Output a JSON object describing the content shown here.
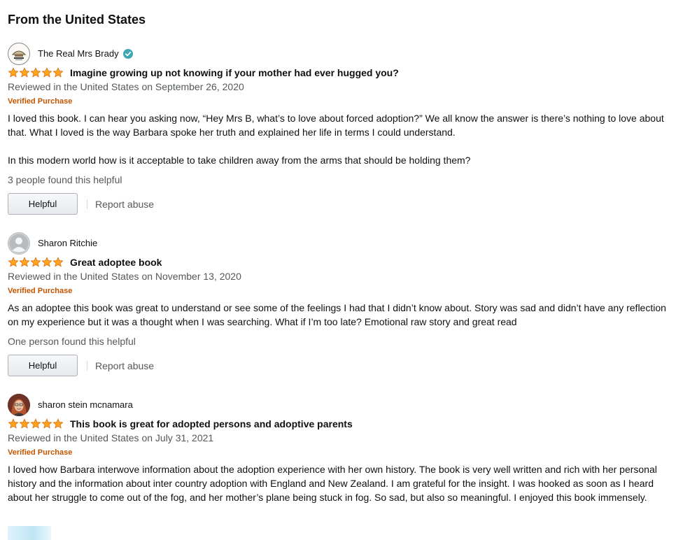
{
  "section": {
    "heading": "From the United States"
  },
  "reviews": [
    {
      "profile_name": "The Real Mrs Brady",
      "verified_reviewer": true,
      "avatar": "book-logo-avatar",
      "rating": 5,
      "title": "Imagine growing up not knowing if your mother had ever hugged you?",
      "date": "Reviewed in the United States on September 26, 2020",
      "badge": "Verified Purchase",
      "body": [
        "I loved this book. I can hear you asking now, “Hey Mrs B, what’s to love about forced adoption?” We all know the answer is there’s nothing to love about that. What I loved is the way Barbara spoke her truth and explained her life in terms I could understand.",
        "In this modern world how is it acceptable to take children away from the arms that should be holding them?"
      ],
      "helpful_count": "3 people found this helpful",
      "helpful_label": "Helpful",
      "report_label": "Report abuse"
    },
    {
      "profile_name": "Sharon Ritchie",
      "verified_reviewer": false,
      "avatar": "default-user-avatar",
      "rating": 5,
      "title": "Great adoptee book",
      "date": "Reviewed in the United States on November 13, 2020",
      "badge": "Verified Purchase",
      "body": [
        "As an adoptee this book was great to understand or see some of the feelings I had that I didn’t know about. Story was sad and didn’t have any reflection on my experience but it was a thought when I was searching. What if I’m too late? Emotional raw story and great read"
      ],
      "helpful_count": "One person found this helpful",
      "helpful_label": "Helpful",
      "report_label": "Report abuse"
    },
    {
      "profile_name": "sharon stein mcnamara",
      "verified_reviewer": false,
      "avatar": "photo-avatar",
      "rating": 5,
      "title": "This book is great for adopted persons and adoptive parents",
      "date": "Reviewed in the United States on July 31, 2021",
      "badge": "Verified Purchase",
      "body": [
        "I loved how Barbara interwove information about the adoption experience with her own history. The book is very well written and rich with her personal history and the information about inter country adoption with England and New Zealand. I am grateful for the insight. I was hooked as soon as I heard about her struggle to come out of the fog, and her mother’s plane being stuck in fog. So sad, but also so meaningful. I enjoyed this book immensely."
      ]
    }
  ],
  "colors": {
    "star": "#ffa41c",
    "star_edge": "#de7921",
    "badge": "#c45500",
    "secondary_text": "#565959",
    "verified_check": "#3fa7b5"
  }
}
